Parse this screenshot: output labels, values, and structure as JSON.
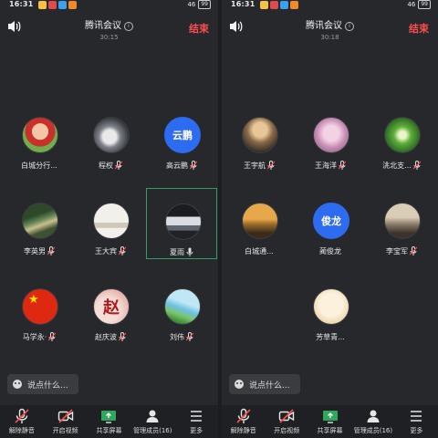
{
  "status_bar": {
    "time": "16:31",
    "battery": "99",
    "network": "46"
  },
  "colors": {
    "end": "#ff4d4d",
    "accent_avatar": "#2d6bf0",
    "selected_border": "#2f9e5e",
    "background": "#26282b"
  },
  "meeting": {
    "title": "腾讯会议",
    "end_label": "结束"
  },
  "left": {
    "timer": "30:15",
    "participants": [
      {
        "name": "白城分行...",
        "muted": false,
        "avatar": "baby-photo"
      },
      {
        "name": "程权",
        "muted": true,
        "avatar": "gray-orb"
      },
      {
        "name": "高云鹏",
        "muted": true,
        "avatar_text": "云鹏"
      },
      {
        "name": "李英男",
        "muted": true,
        "avatar": "green-road"
      },
      {
        "name": "王大宾",
        "muted": true,
        "avatar": "sketch-poem"
      },
      {
        "name": "夏雨",
        "muted": true,
        "avatar": "car",
        "active": true
      },
      {
        "name": "马学永·",
        "muted": true,
        "avatar": "china-flag"
      },
      {
        "name": "赵庆波",
        "muted": true,
        "avatar": "zhao-character"
      },
      {
        "name": "刘伟",
        "muted": true,
        "avatar": "palm-sky"
      }
    ],
    "chat_placeholder": "说点什么...",
    "page": 1
  },
  "right": {
    "timer": "30:18",
    "participants": [
      {
        "name": "王宇航",
        "muted": true,
        "avatar": "dusk-person"
      },
      {
        "name": "王海洋",
        "muted": true,
        "avatar": "pink-hat"
      },
      {
        "name": "洮北支...",
        "muted": true,
        "avatar": "green-arch"
      },
      {
        "name": "白城通...",
        "muted": false,
        "avatar": "sunset-figure"
      },
      {
        "name": "蔺俊龙",
        "muted": false,
        "avatar_text": "俊龙"
      },
      {
        "name": "李宝军",
        "muted": true,
        "avatar": "sitting-woman"
      },
      {
        "name": "芳草青...",
        "muted": false,
        "avatar": "cartoon-girl"
      }
    ],
    "chat_placeholder": "说点什么...",
    "page": 2
  },
  "toolbar": {
    "unmute": "解除静音",
    "video": "开启视频",
    "share": "共享屏幕",
    "members": "管理成员(16)",
    "more": "更多"
  },
  "icons": [
    "speaker-icon",
    "info-icon",
    "mic-muted-icon",
    "mic-icon",
    "video-off-icon",
    "share-screen-icon",
    "members-icon",
    "more-icon",
    "chat-emoji-icon"
  ]
}
